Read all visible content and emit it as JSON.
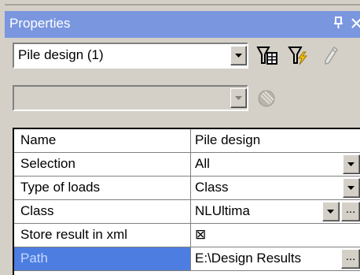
{
  "panel": {
    "title": "Properties",
    "pin_glyph": "p",
    "close_glyph": "×"
  },
  "object_selector": {
    "value": "Pile design (1)"
  },
  "secondary_selector": {
    "value": ""
  },
  "toolbar": {
    "icons": [
      "filter-table-icon",
      "filter-lightning-icon",
      "pencil-icon",
      "disabled-gear-icon"
    ]
  },
  "properties": {
    "rows": [
      {
        "label": "Name",
        "value": "Pile design",
        "control": "text"
      },
      {
        "label": "Selection",
        "value": "All",
        "control": "dropdown"
      },
      {
        "label": "Type of loads",
        "value": "Class",
        "control": "dropdown"
      },
      {
        "label": "Class",
        "value": "NLUltima",
        "control": "dropdown+ellipsis"
      },
      {
        "label": "Store result in xml",
        "value": "⊠",
        "control": "checkbox",
        "checked": true
      },
      {
        "label": "Path",
        "value": "E:\\Design Results",
        "control": "ellipsis",
        "selected": true
      }
    ],
    "ellipsis_label": "..."
  },
  "colors": {
    "titlebar": "#7a96df",
    "selected_label_bg": "#4d7de0",
    "face": "#d4d0c8"
  }
}
